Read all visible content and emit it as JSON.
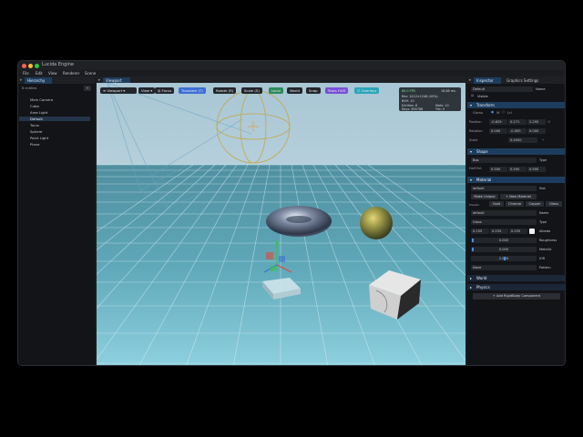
{
  "window": {
    "title": "Lucida Engine"
  },
  "menu": [
    "File",
    "Edit",
    "View",
    "Renderer",
    "Scene"
  ],
  "hierarchy": {
    "tab": "Hierarchy",
    "count": "8 entities",
    "add_label": "+",
    "items": [
      "Main Camera",
      "Cube",
      "Area Light",
      "Default",
      "Torus",
      "Sphere",
      "Point Light",
      "Plane"
    ],
    "selected_index": 3
  },
  "viewport": {
    "tab": "Viewport",
    "toolbar": {
      "viewport_select": "Viewport",
      "view": "View",
      "focus": "Focus",
      "translate": "Translate (T)",
      "rotate": "Rotate (R)",
      "scale": "Scale (S)",
      "local": "Local",
      "world": "World",
      "snap": "Snap",
      "stats": "Stats HUD",
      "overlays": "Overlays"
    },
    "stats": {
      "fps": "60.0 FPS",
      "ms": "16.68 ms",
      "res": "Res: 1412×1248 (45%)",
      "bvh": "BVH: 10",
      "entities": "Entities: 8",
      "mats": "Mats: 10",
      "rays": "Rays: 694768",
      "tris": "Tris: 0"
    }
  },
  "inspector": {
    "tabs": [
      "Inspector",
      "Graphics Settings"
    ],
    "name_value": "Default",
    "name_label": "Name",
    "visible_label": "Visible",
    "transform": {
      "header": "Transform",
      "gizmo_label": "Gizmo",
      "gizmo_opt1": "W",
      "gizmo_opt2": "Lcl",
      "position_label": "Position",
      "position": [
        "-0.629",
        "0.271",
        "2.295"
      ],
      "rotation_label": "Rotation",
      "rotation": [
        "0.000",
        "-0.000",
        "0.000"
      ],
      "scale_label": "Scale",
      "scale": "0.4000"
    },
    "shape": {
      "header": "Shape",
      "type_value": "Box",
      "type_label": "Type",
      "half_ext_label": "Half Ext",
      "half_ext": [
        "0.500",
        "0.500",
        "0.500"
      ]
    },
    "material": {
      "header": "Material",
      "slot_value": "default",
      "slot_label": "Slot",
      "make_unique": "Make Unique",
      "new_material": "+ New Material",
      "presets_label": "Presets",
      "presets": [
        "Gold",
        "Chrome",
        "Copper",
        "Glass"
      ],
      "name_value": "default",
      "name_label": "Name",
      "type_value": "Glass",
      "type_label": "Type",
      "albedo": [
        "0.255",
        "0.255",
        "0.255"
      ],
      "albedo_label": "Albedo",
      "roughness_value": "0.000",
      "roughness_label": "Roughness",
      "metallic_value": "0.000",
      "metallic_label": "Metallic",
      "ior_value": "2.000",
      "ior_label": "IOR",
      "pattern_value": "None",
      "pattern_label": "Pattern"
    },
    "world_header": "World",
    "physics_header": "Physics",
    "add_rigidbody": "+ Add RigidBody Component"
  },
  "colors": {
    "accent": "#1d3d5e",
    "translate": "#3b6fd6",
    "local": "#2d8a5a",
    "stats": "#7a4fd6",
    "overlays": "#2aa5b8"
  }
}
